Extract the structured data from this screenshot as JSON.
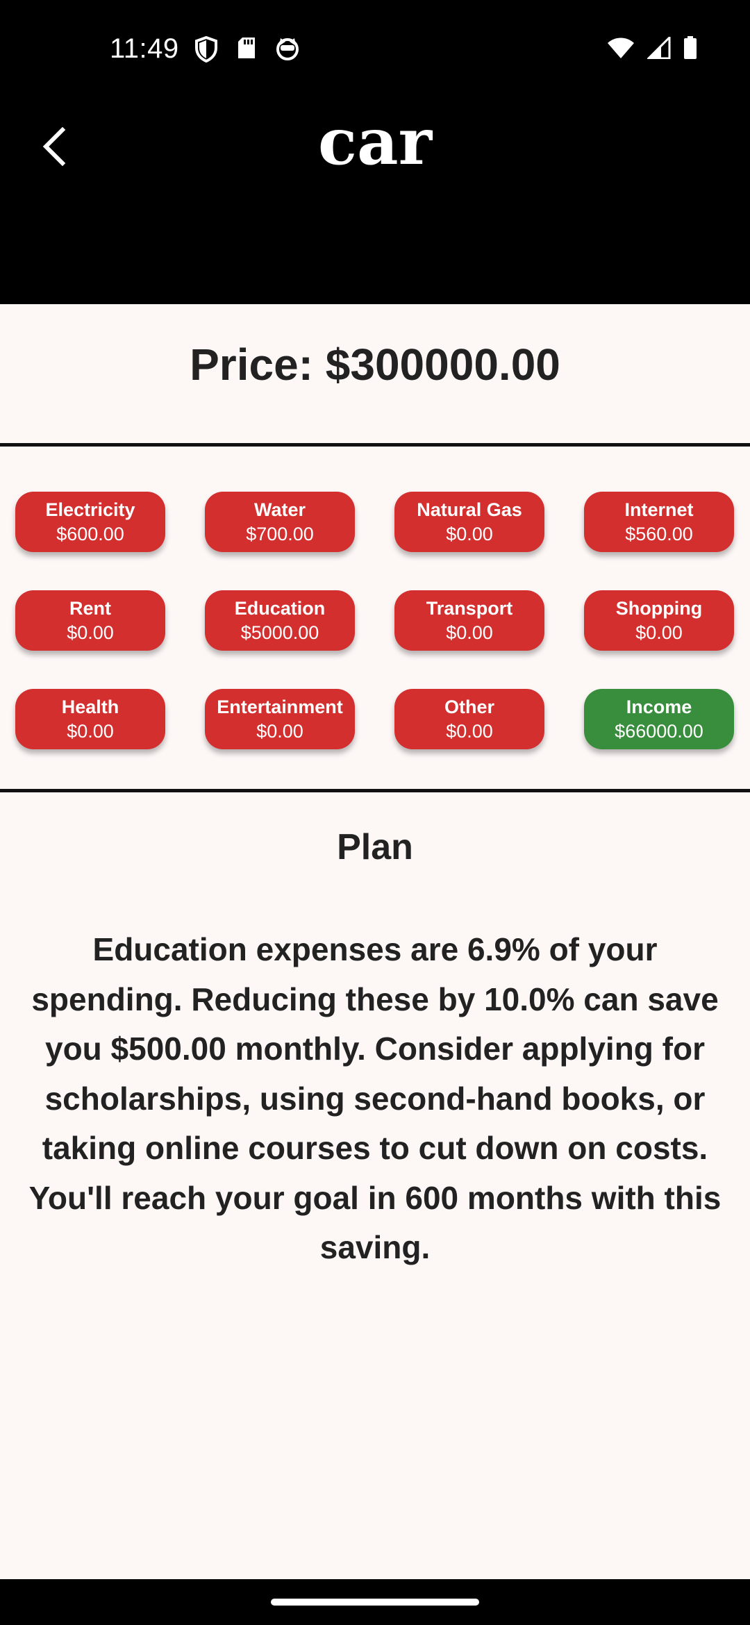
{
  "status_bar": {
    "time": "11:49",
    "left_icons": [
      "shield-icon",
      "sd-card-icon",
      "cat-face-icon"
    ],
    "right_icons": [
      "wifi-icon",
      "signal-icon",
      "battery-icon"
    ]
  },
  "app_bar": {
    "back_icon": "chevron-left-icon",
    "title": "car"
  },
  "price_text": "Price: $300000.00",
  "categories": [
    {
      "name": "Electricity",
      "amount": "$600.00"
    },
    {
      "name": "Water",
      "amount": "$700.00"
    },
    {
      "name": "Natural Gas",
      "amount": "$0.00"
    },
    {
      "name": "Internet",
      "amount": "$560.00"
    },
    {
      "name": "Rent",
      "amount": "$0.00"
    },
    {
      "name": "Education",
      "amount": "$5000.00"
    },
    {
      "name": "Transport",
      "amount": "$0.00"
    },
    {
      "name": "Shopping",
      "amount": "$0.00"
    },
    {
      "name": "Health",
      "amount": "$0.00"
    },
    {
      "name": "Entertainment",
      "amount": "$0.00"
    },
    {
      "name": "Other",
      "amount": "$0.00"
    },
    {
      "name": "Income",
      "amount": "$66000.00"
    }
  ],
  "colors": {
    "expense_chip": "#d32f2f",
    "income_chip": "#388e3c",
    "background": "#fdf7f6",
    "topbar": "#000000"
  },
  "plan": {
    "title": "Plan",
    "text": "Education expenses are 6.9% of your spending. Reducing these by 10.0% can save you $500.00 monthly. Consider applying for scholarships, using second-hand books, or taking online courses to cut down on costs. You'll reach your goal in 600 months with this saving."
  }
}
